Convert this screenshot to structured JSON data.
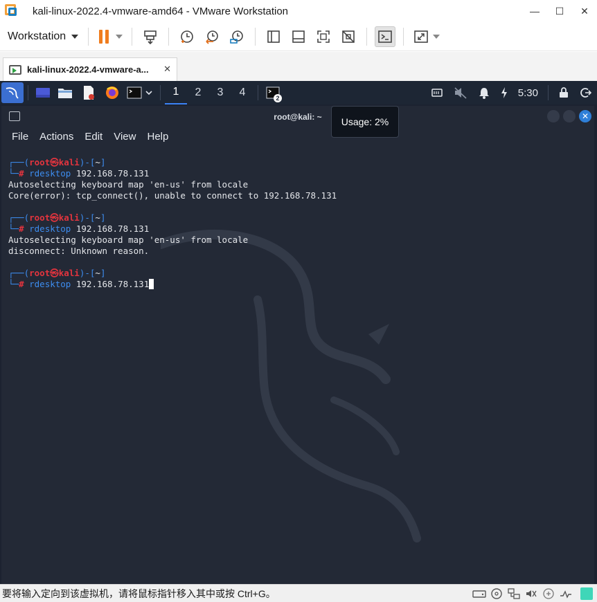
{
  "window": {
    "title": "kali-linux-2022.4-vmware-amd64 - VMware Workstation",
    "minimize": "—",
    "maximize": "☐",
    "close": "✕"
  },
  "toolbar": {
    "menu_label": "Workstation"
  },
  "tab": {
    "label": "kali-linux-2022.4-vmware-a...",
    "close": "✕"
  },
  "kali_panel": {
    "workspaces": [
      "1",
      "2",
      "3",
      "4"
    ],
    "active_workspace": "1",
    "task_badge": "2",
    "clock": "5:30"
  },
  "terminal": {
    "title": "root@kali: ~",
    "menu": [
      "File",
      "Actions",
      "Edit",
      "View",
      "Help"
    ],
    "prompt_user": "root",
    "prompt_at": "㉿",
    "prompt_host": "kali",
    "prompt_dir": "~",
    "blocks": [
      {
        "command": "rdesktop 192.168.78.131",
        "output": [
          "Autoselecting keyboard map 'en-us' from locale",
          "Core(error): tcp_connect(), unable to connect to 192.168.78.131"
        ]
      },
      {
        "command": "rdesktop 192.168.78.131",
        "output": [
          "Autoselecting keyboard map 'en-us' from locale",
          "disconnect: Unknown reason."
        ]
      },
      {
        "command": "rdesktop 192.168.78.131",
        "output": []
      }
    ]
  },
  "tooltip": {
    "text": "Usage: 2%"
  },
  "statusbar": {
    "text": "要将输入定向到该虚拟机，请将鼠标指针移入其中或按 Ctrl+G。"
  },
  "colors": {
    "accent_orange": "#f07d1e",
    "kali_panel_bg": "#1d2634",
    "terminal_bg": "#232936",
    "prompt_blue": "#3d8df0",
    "prompt_red": "#e3343e"
  }
}
